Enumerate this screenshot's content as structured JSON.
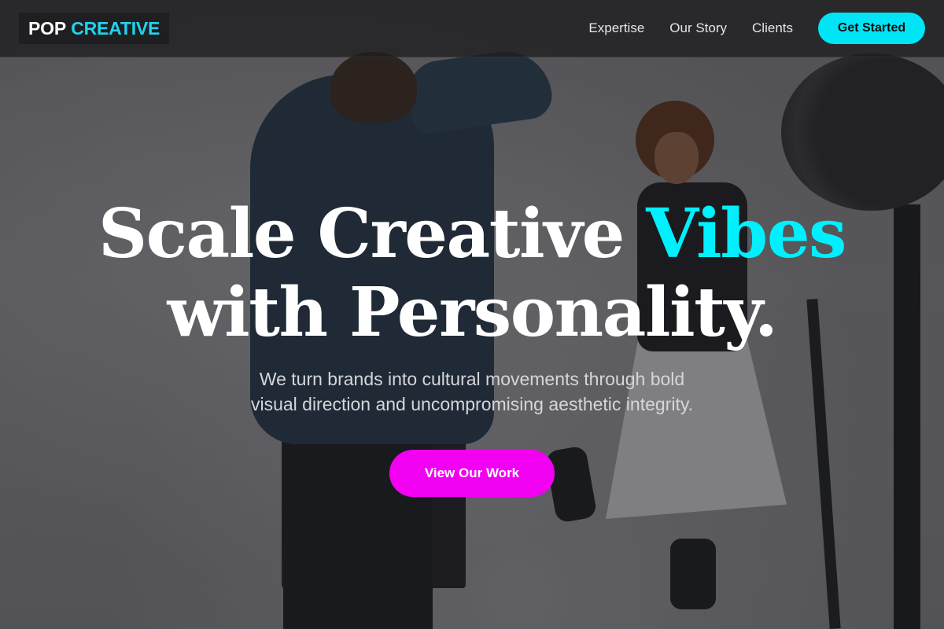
{
  "colors": {
    "accent_cyan": "#00e5f5",
    "accent_magenta": "#f200f2",
    "logo_creative": "#22d3ee",
    "nav_background": "#1e1e20"
  },
  "brand": {
    "logo_first": "POP",
    "logo_second": "CREATIVE"
  },
  "navbar": {
    "links": [
      {
        "label": "Expertise"
      },
      {
        "label": "Our Story"
      },
      {
        "label": "Clients"
      }
    ],
    "cta_label": "Get Started"
  },
  "hero": {
    "title_line1_part1": "Scale Creative",
    "title_line1_accent": "Vibes",
    "title_line2": "with Personality.",
    "subtitle_line1": "We turn brands into cultural movements through bold",
    "subtitle_line2": "visual direction and uncompromising aesthetic integrity.",
    "button_label": "View Our Work",
    "background_image": "photo of photographer shooting a smiling model in a studio with a studio light"
  }
}
